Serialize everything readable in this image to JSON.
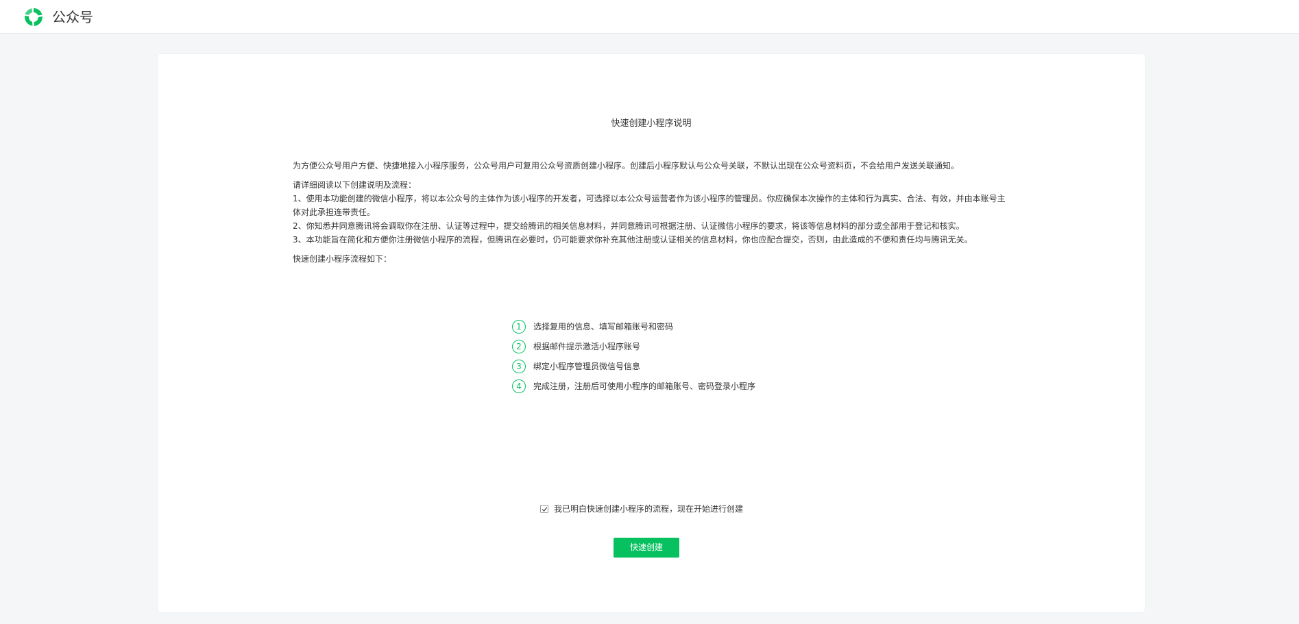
{
  "header": {
    "brand": "公众号",
    "logo_icon": "wechat-official-account-logo-icon"
  },
  "main": {
    "title": "快速创建小程序说明",
    "intro": "为方便公众号用户方便、快捷地接入小程序服务，公众号用户可复用公众号资质创建小程序。创建后小程序默认与公众号关联，不默认出现在公众号资料页，不会给用户发送关联通知。",
    "requirements_title": "请详细阅读以下创建说明及流程：",
    "requirements": [
      "1、使用本功能创建的微信小程序，将以本公众号的主体作为该小程序的开发者，可选择以本公众号运营者作为该小程序的管理员。你应确保本次操作的主体和行为真实、合法、有效，并由本账号主体对此承担连带责任。",
      "2、你知悉并同意腾讯将会调取你在注册、认证等过程中，提交给腾讯的相关信息材料，并同意腾讯可根据注册、认证微信小程序的要求，将该等信息材料的部分或全部用于登记和核实。",
      "3、本功能旨在简化和方便你注册微信小程序的流程，但腾讯在必要时，仍可能要求你补充其他注册或认证相关的信息材料，你也应配合提交，否则，由此造成的不便和责任均与腾讯无关。"
    ],
    "flow_title": "快速创建小程序流程如下：",
    "steps": [
      {
        "num": "1",
        "text": "选择复用的信息、填写邮箱账号和密码"
      },
      {
        "num": "2",
        "text": "根据邮件提示激活小程序账号"
      },
      {
        "num": "3",
        "text": "绑定小程序管理员微信号信息"
      },
      {
        "num": "4",
        "text": "完成注册，注册后可使用小程序的邮箱账号、密码登录小程序"
      }
    ],
    "agree_label": "我已明白快速创建小程序的流程，现在开始进行创建",
    "agree_checked": true,
    "create_button": "快速创建"
  },
  "colors": {
    "brand_green": "#07c160",
    "background": "#f5f6f7",
    "text": "#353535"
  }
}
